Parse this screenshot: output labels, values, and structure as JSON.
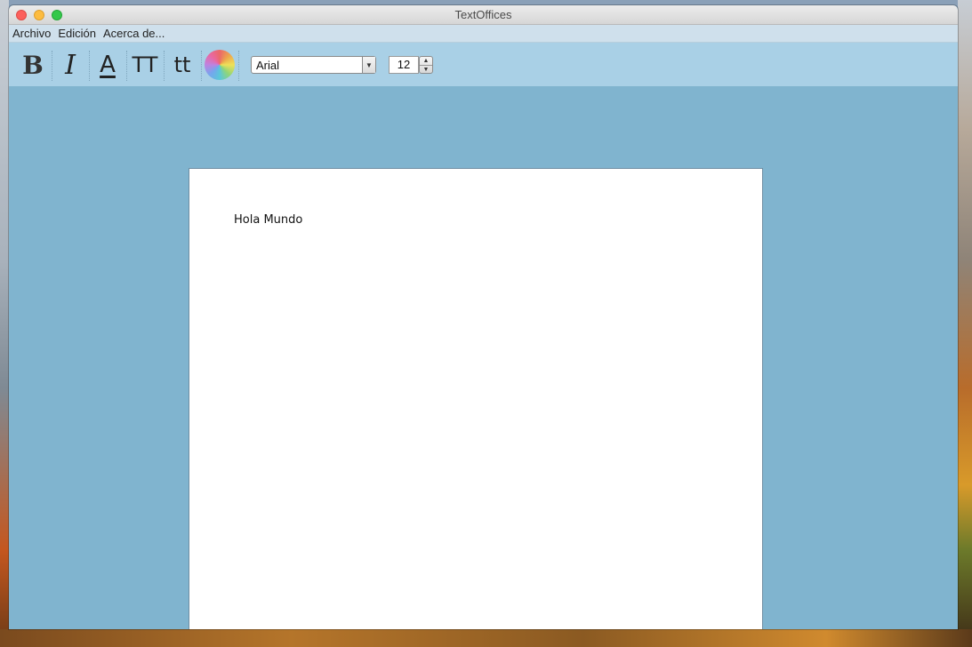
{
  "window": {
    "title": "TextOffices"
  },
  "menubar": {
    "items": [
      "Archivo",
      "Edición",
      "Acerca de..."
    ]
  },
  "toolbar": {
    "bold_glyph": "B",
    "italic_glyph": "I",
    "underline_glyph": "A",
    "uppercase_glyph": "TT",
    "lowercase_glyph": "tt",
    "font_select": {
      "value": "Arial"
    },
    "font_size": {
      "value": "12"
    }
  },
  "document": {
    "text": "Hola Mundo"
  },
  "colors": {
    "toolbar": "#a9d0e6",
    "menubar": "#cfe0ec",
    "workspace": "#80b4cf",
    "page": "#ffffff"
  },
  "icons": {
    "color_picker": "color-wheel-icon",
    "dropdown": "chevron-down-icon"
  }
}
